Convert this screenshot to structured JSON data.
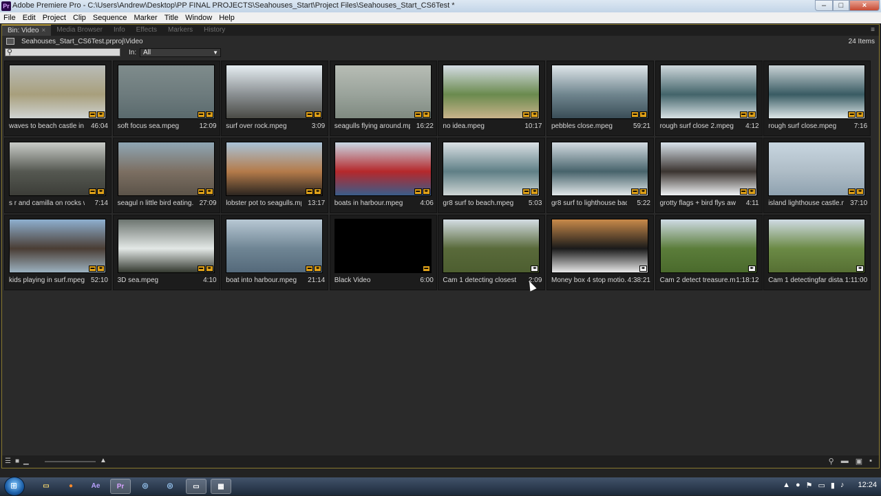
{
  "window": {
    "title": "Adobe Premiere Pro - C:\\Users\\Andrew\\Desktop\\PP FINAL PROJECTS\\Seahouses_Start\\Project Files\\Seahouses_Start_CS6Test *",
    "app_icon": "Pr"
  },
  "menu": [
    "File",
    "Edit",
    "Project",
    "Clip",
    "Sequence",
    "Marker",
    "Title",
    "Window",
    "Help"
  ],
  "tabs": [
    {
      "label": "Bin: Video",
      "active": true
    },
    {
      "label": "Media Browser"
    },
    {
      "label": "Info"
    },
    {
      "label": "Effects"
    },
    {
      "label": "Markers"
    },
    {
      "label": "History"
    }
  ],
  "bin": {
    "path": "Seahouses_Start_CS6Test.prproj\\Video",
    "count": "24 Items",
    "in_label": "In:",
    "in_value": "All"
  },
  "clips": [
    {
      "name": "waves to beach castle in b...",
      "dur": "46:04",
      "colors": [
        "#b9bcb8",
        "#a89f7c",
        "#cfd3d2"
      ],
      "badge": "av"
    },
    {
      "name": "soft focus sea.mpeg",
      "dur": "12:09",
      "colors": [
        "#7f8c8c",
        "#6d7b7d",
        "#5a6a6d"
      ],
      "badge": "av"
    },
    {
      "name": "surf over rock.mpeg",
      "dur": "3:09",
      "colors": [
        "#e6eef2",
        "#8a8f92",
        "#4a4a45"
      ],
      "badge": "av"
    },
    {
      "name": "seagulls flying around.mp...",
      "dur": "16:22",
      "colors": [
        "#b7bdb5",
        "#9aa39b",
        "#7f8a80"
      ],
      "badge": "av"
    },
    {
      "name": "no idea.mpeg",
      "dur": "10:17",
      "colors": [
        "#d5dde5",
        "#6a8a4e",
        "#c9b38a"
      ],
      "badge": "av"
    },
    {
      "name": "pebbles close.mpeg",
      "dur": "59:21",
      "colors": [
        "#dfe6ea",
        "#6f858e",
        "#3a4d57"
      ],
      "badge": "av"
    },
    {
      "name": "rough surf close 2.mpeg",
      "dur": "4:12",
      "colors": [
        "#cfd8dc",
        "#43646a",
        "#d8e2e5"
      ],
      "badge": "av"
    },
    {
      "name": "rough surf close.mpeg",
      "dur": "7:16",
      "colors": [
        "#cad3d6",
        "#395b63",
        "#dde6e8"
      ],
      "badge": "av"
    },
    {
      "name": "s r and camilla on rocks wit...",
      "dur": "7:14",
      "colors": [
        "#c9ccc8",
        "#555851",
        "#3c3d38"
      ],
      "badge": "av"
    },
    {
      "name": "seagul n little bird eating....",
      "dur": "27:09",
      "colors": [
        "#8fa6b4",
        "#7c6f62",
        "#5b5349"
      ],
      "badge": "av"
    },
    {
      "name": "lobster pot to seagulls.mp...",
      "dur": "13:17",
      "colors": [
        "#a9c3d8",
        "#b47b4a",
        "#2b2520"
      ],
      "badge": "av"
    },
    {
      "name": "boats in harbour.mpeg",
      "dur": "4:06",
      "colors": [
        "#cad9e6",
        "#b5282b",
        "#3a5d8a"
      ],
      "badge": "av"
    },
    {
      "name": "gr8 surf to beach.mpeg",
      "dur": "5:03",
      "colors": [
        "#dbe1e5",
        "#5f7f86",
        "#cfd6d5"
      ],
      "badge": "av"
    },
    {
      "name": "gr8 surf to lighthouse back....",
      "dur": "5:22",
      "colors": [
        "#d4dce2",
        "#47636b",
        "#e2e8ea"
      ],
      "badge": "av"
    },
    {
      "name": "grotty flags + bird flys awa...",
      "dur": "4:11",
      "colors": [
        "#d9e3ec",
        "#3b3430",
        "#f0f3f5"
      ],
      "badge": "av"
    },
    {
      "name": "island lighthouse castle.m...",
      "dur": "37:10",
      "colors": [
        "#c8d6e0",
        "#aebcc6",
        "#8fa2b0"
      ],
      "badge": "av"
    },
    {
      "name": "kids playing in surf.mpeg",
      "dur": "52:10",
      "colors": [
        "#8fb0d0",
        "#4a3d34",
        "#9cb2c0"
      ],
      "badge": "av"
    },
    {
      "name": "3D sea.mpeg",
      "dur": "4:10",
      "colors": [
        "#6d7570",
        "#e3e8e6",
        "#33382f"
      ],
      "badge": "av"
    },
    {
      "name": "boat into harbour.mpeg",
      "dur": "21:14",
      "colors": [
        "#b8c8d4",
        "#6f8594",
        "#54697a"
      ],
      "badge": "av"
    },
    {
      "name": "Black Video",
      "dur": "6:00",
      "colors": [
        "#000000",
        "#000000",
        "#000000"
      ],
      "badge": "v"
    },
    {
      "name": "Cam 1 detecting closest di...",
      "dur": "2:09",
      "colors": [
        "#d4dde4",
        "#596a3a",
        "#4d5e30"
      ],
      "badge": "w"
    },
    {
      "name": "Money box 4 stop motio...",
      "dur": "4:38:21",
      "colors": [
        "#c98a4a",
        "#1a1a1a",
        "#e8e8e8"
      ],
      "badge": "w"
    },
    {
      "name": "Cam 2 detect treasure.m...",
      "dur": "1:18:12",
      "colors": [
        "#cfdbe5",
        "#5b7d3a",
        "#4a6a2c"
      ],
      "badge": "w"
    },
    {
      "name": "Cam 1 detectingfar dista...",
      "dur": "1:11:00",
      "colors": [
        "#d0dbe4",
        "#6b8a45",
        "#566f33"
      ],
      "badge": "w"
    }
  ],
  "taskbar": {
    "clock": "12:24",
    "apps": [
      "Explorer",
      "Firefox",
      "Ae",
      "Pr",
      "Chrome",
      "Chrome",
      "Window",
      "Media"
    ]
  }
}
